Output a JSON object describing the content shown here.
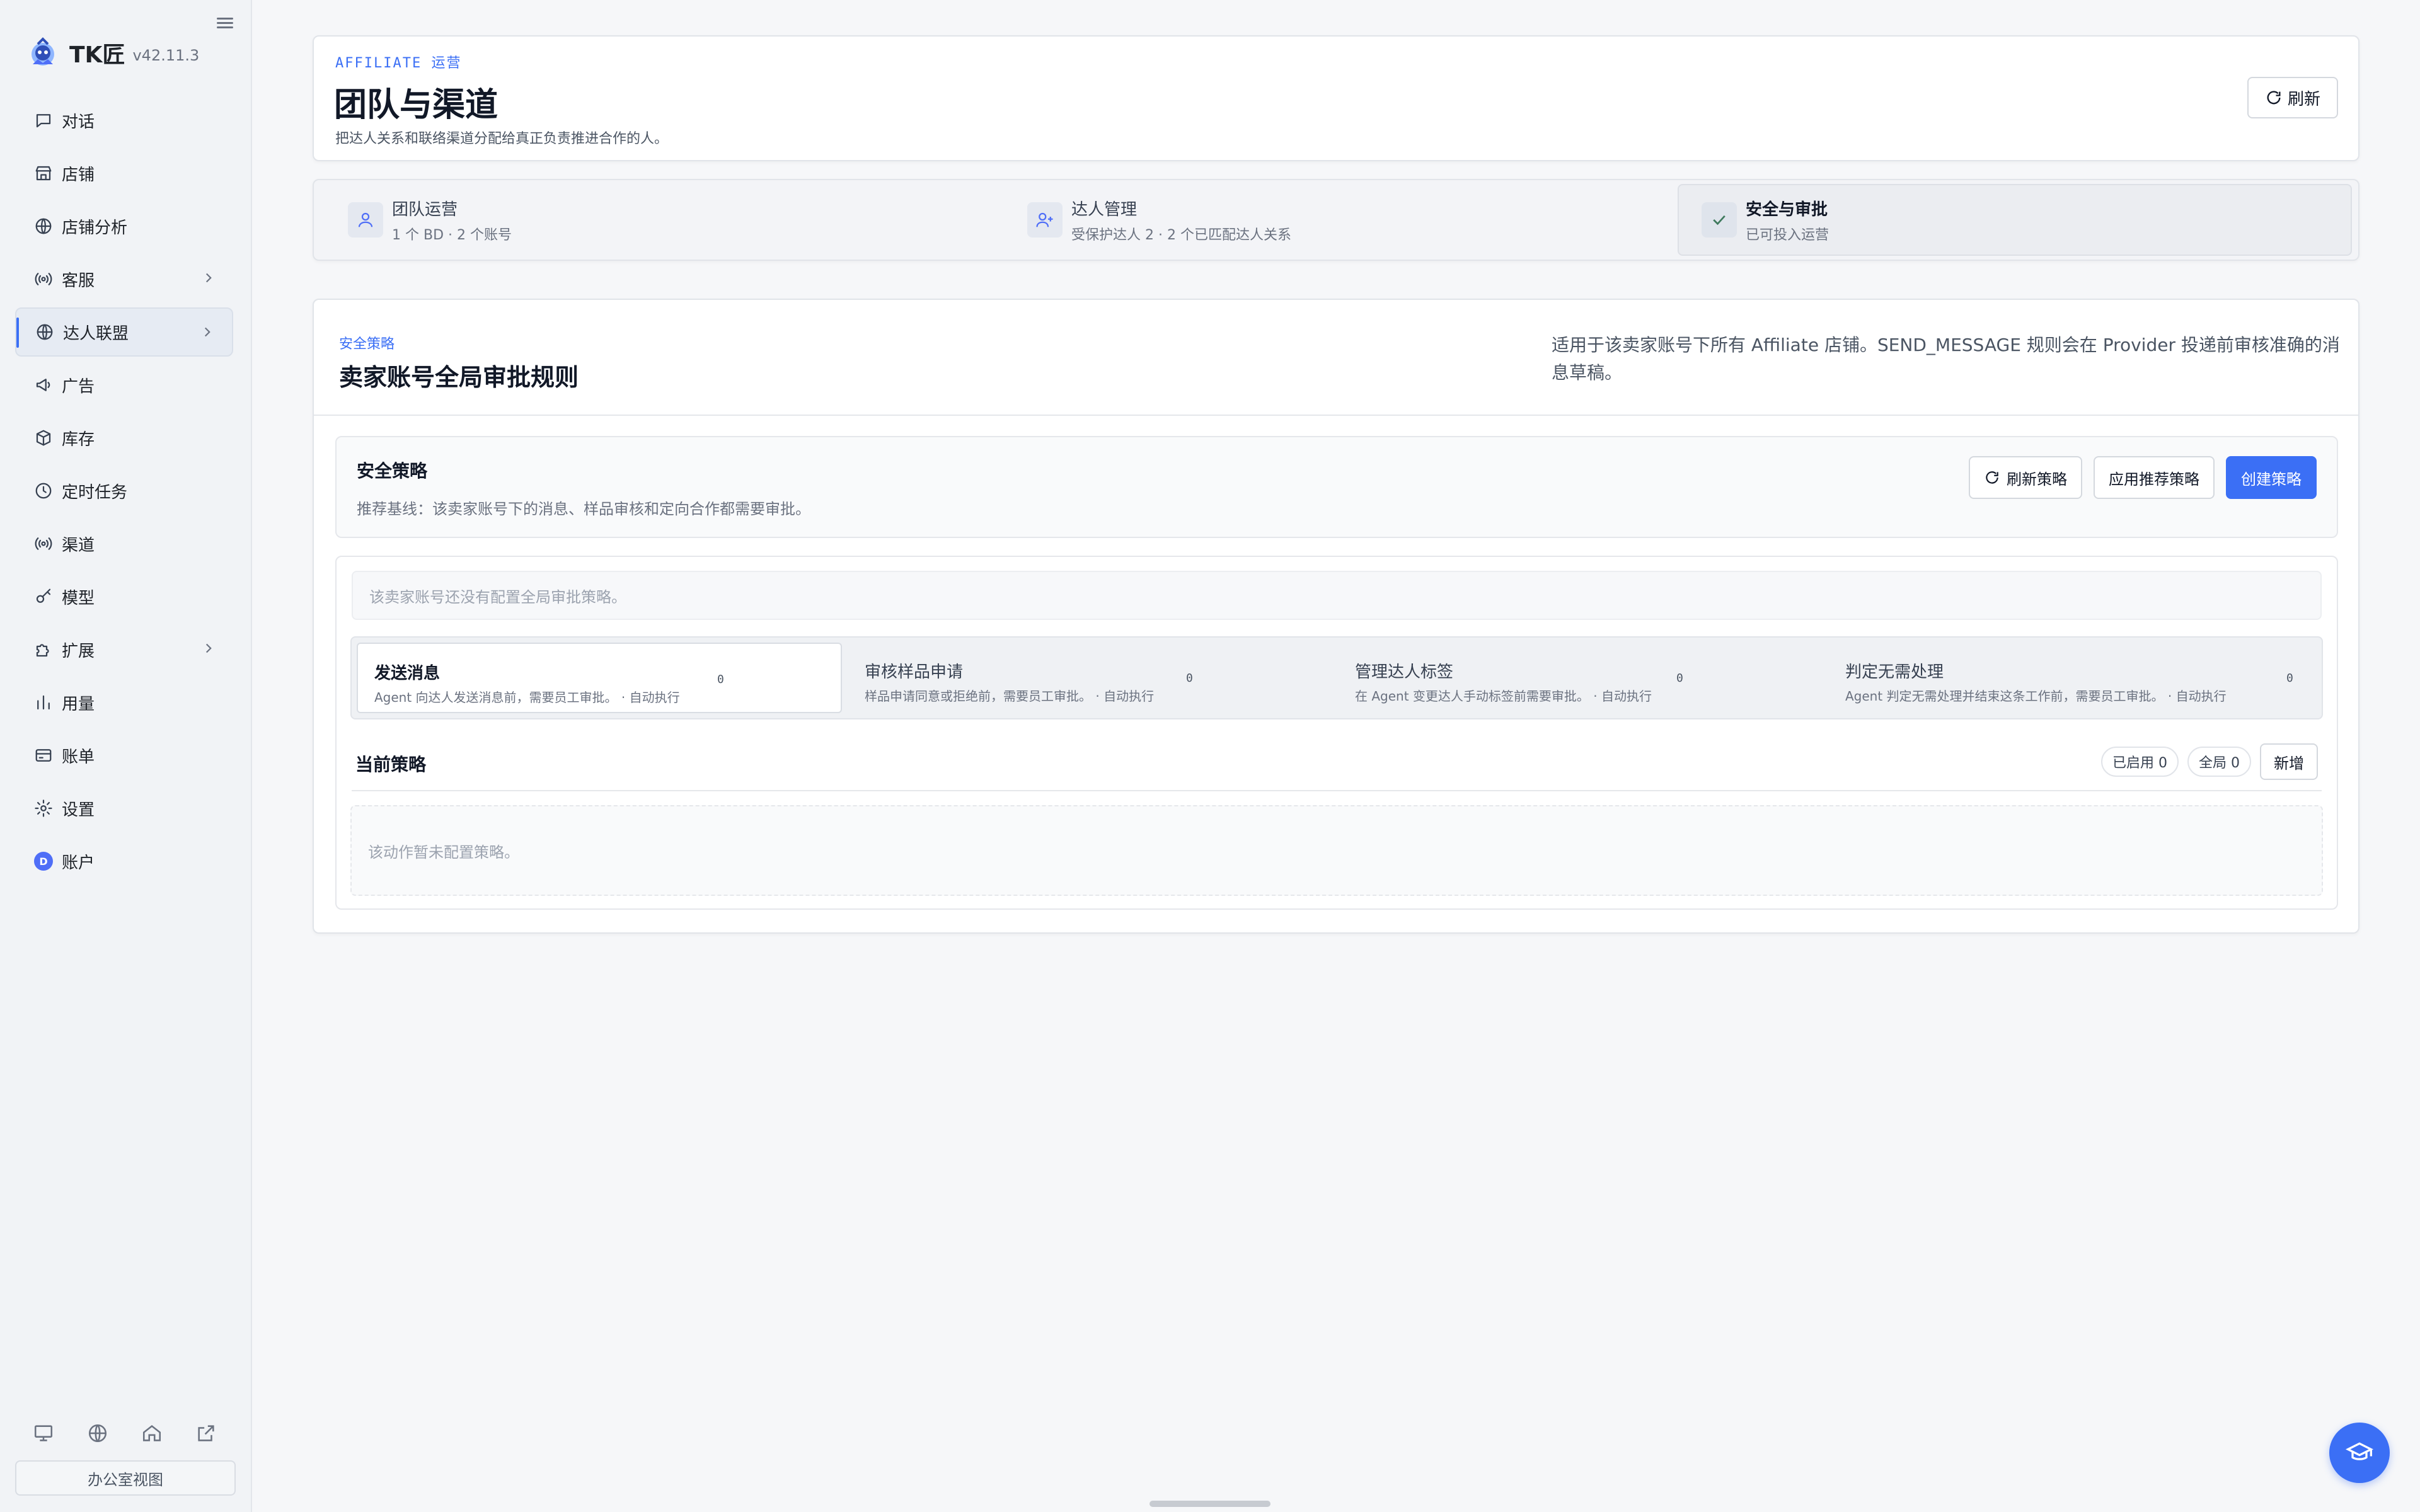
{
  "brand": {
    "name": "TK匠",
    "version": "v42.11.3"
  },
  "sidebar": {
    "items": [
      {
        "label": "对话",
        "icon": "chat-icon",
        "active": false,
        "has_chevron": false
      },
      {
        "label": "店铺",
        "icon": "store-icon",
        "active": false,
        "has_chevron": false
      },
      {
        "label": "店铺分析",
        "icon": "globe-icon",
        "active": false,
        "has_chevron": false
      },
      {
        "label": "客服",
        "icon": "broadcast-icon",
        "active": false,
        "has_chevron": true
      },
      {
        "label": "达人联盟",
        "icon": "globe-icon",
        "active": true,
        "has_chevron": true
      },
      {
        "label": "广告",
        "icon": "megaphone-icon",
        "active": false,
        "has_chevron": false
      },
      {
        "label": "库存",
        "icon": "box-icon",
        "active": false,
        "has_chevron": false
      },
      {
        "label": "定时任务",
        "icon": "clock-icon",
        "active": false,
        "has_chevron": false
      },
      {
        "label": "渠道",
        "icon": "broadcast-icon",
        "active": false,
        "has_chevron": false
      },
      {
        "label": "模型",
        "icon": "key-icon",
        "active": false,
        "has_chevron": false
      },
      {
        "label": "扩展",
        "icon": "puzzle-icon",
        "active": false,
        "has_chevron": true
      },
      {
        "label": "用量",
        "icon": "bar-chart-icon",
        "active": false,
        "has_chevron": false
      },
      {
        "label": "账单",
        "icon": "credit-card-icon",
        "active": false,
        "has_chevron": false
      },
      {
        "label": "设置",
        "icon": "gear-icon",
        "active": false,
        "has_chevron": false
      },
      {
        "label": "账户",
        "icon": "avatar",
        "avatar_letter": "D",
        "active": false,
        "has_chevron": false
      }
    ],
    "bottom_icons": [
      "monitor-icon",
      "globe-icon",
      "home-icon",
      "external-link-icon"
    ],
    "office_view_label": "办公室视图"
  },
  "header": {
    "eyebrow": "AFFILIATE 运营",
    "title": "团队与渠道",
    "subtitle": "把达人关系和联络渠道分配给真正负责推进合作的人。",
    "refresh_label": "刷新"
  },
  "steps": [
    {
      "title": "团队运营",
      "sub": "1 个 BD · 2 个账号",
      "icon": "user-icon",
      "active": false
    },
    {
      "title": "达人管理",
      "sub": "受保护达人 2 · 2 个已匹配达人关系",
      "icon": "user-plus-icon",
      "active": false
    },
    {
      "title": "安全与审批",
      "sub": "已可投入运营",
      "icon": "check-icon",
      "active": true
    }
  ],
  "policy": {
    "eyebrow": "安全策略",
    "title": "卖家账号全局审批规则",
    "description": "适用于该卖家账号下所有 Affiliate 店铺。SEND_MESSAGE 规则会在 Provider 投递前审核准确的消息草稿。",
    "section": {
      "title": "安全策略",
      "subtitle": "推荐基线：该卖家账号下的消息、样品审核和定向合作都需要审批。",
      "refresh_label": "刷新策略",
      "apply_label": "应用推荐策略",
      "create_label": "创建策略"
    },
    "empty_global": "该卖家账号还没有配置全局审批策略。",
    "actions": [
      {
        "title": "发送消息",
        "desc": "Agent 向达人发送消息前，需要员工审批。 · 自动执行",
        "count": "0",
        "active": true
      },
      {
        "title": "审核样品申请",
        "desc": "样品申请同意或拒绝前，需要员工审批。 · 自动执行",
        "count": "0",
        "active": false
      },
      {
        "title": "管理达人标签",
        "desc": "在 Agent 变更达人手动标签前需要审批。 · 自动执行",
        "count": "0",
        "active": false
      },
      {
        "title": "判定无需处理",
        "desc": "Agent 判定无需处理并结束这条工作前，需要员工审批。 · 自动执行",
        "count": "0",
        "active": false
      }
    ],
    "current": {
      "title": "当前策略",
      "enabled_label": "已启用 0",
      "global_label": "全局 0",
      "add_label": "新增",
      "empty": "该动作暂未配置策略。"
    }
  },
  "colors": {
    "accent": "#3b6ff5",
    "sidebar_bg": "#f1f3f6",
    "page_bg": "#f6f7f9"
  }
}
